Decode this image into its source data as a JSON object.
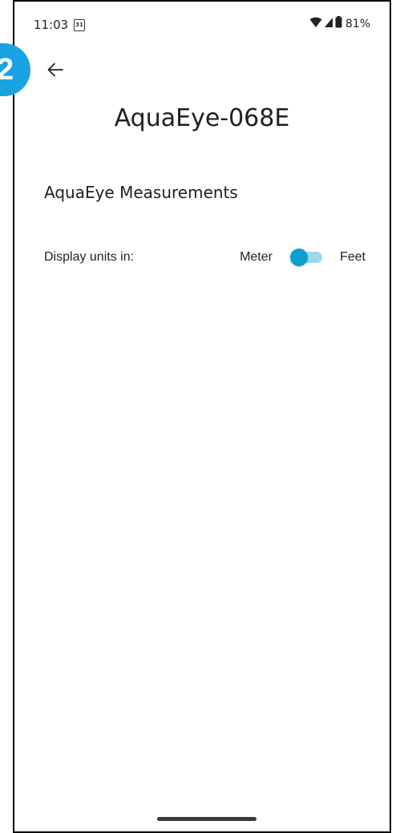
{
  "status_bar": {
    "time": "11:03",
    "calendar_day": "31",
    "battery": "81%",
    "wifi_icon": "wifi-icon",
    "signal_icon": "signal-icon",
    "battery_icon": "battery-icon"
  },
  "step_badge": "2",
  "header": {
    "back_icon": "arrow-left-icon",
    "title": "AquaEye-068E"
  },
  "section": {
    "title": "AquaEye Measurements"
  },
  "units": {
    "label": "Display units in:",
    "option_left": "Meter",
    "option_right": "Feet",
    "selected": "Meter"
  },
  "colors": {
    "accent": "#0b9fd1",
    "accent_track": "#9ad8ec",
    "badge": "#1aa3e0"
  }
}
